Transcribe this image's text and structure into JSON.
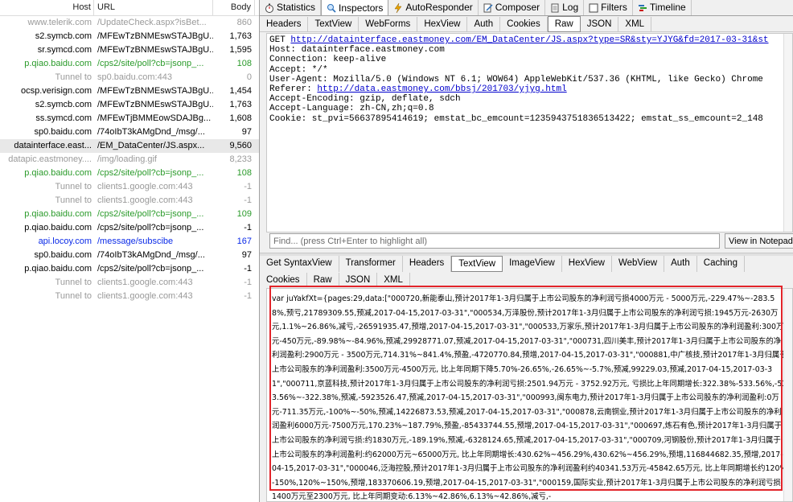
{
  "sessions": {
    "headers": {
      "host": "Host",
      "url": "URL",
      "body": "Body"
    },
    "rows": [
      {
        "host": "www.telerik.com",
        "url": "/UpdateCheck.aspx?isBet...",
        "body": "860",
        "style": "gray"
      },
      {
        "host": "s2.symcb.com",
        "url": "/MFEwTzBNMEswSTAJBgU...",
        "body": "1,763",
        "style": ""
      },
      {
        "host": "sr.symcd.com",
        "url": "/MFEwTzBNMEswSTAJBgU...",
        "body": "1,595",
        "style": ""
      },
      {
        "host": "p.qiao.baidu.com",
        "url": "/cps2/site/poll?cb=jsonp_...",
        "body": "108",
        "style": "green"
      },
      {
        "host": "Tunnel to",
        "url": "sp0.baidu.com:443",
        "body": "0",
        "style": "gray"
      },
      {
        "host": "ocsp.verisign.com",
        "url": "/MFEwTzBNMEswSTAJBgU...",
        "body": "1,454",
        "style": ""
      },
      {
        "host": "s2.symcb.com",
        "url": "/MFEwTzBNMEswSTAJBgU...",
        "body": "1,763",
        "style": ""
      },
      {
        "host": "ss.symcd.com",
        "url": "/MFEwTjBMMEowSDAJBg...",
        "body": "1,608",
        "style": ""
      },
      {
        "host": "sp0.baidu.com",
        "url": "/74oIbT3kAMgDnd_/msg/...",
        "body": "97",
        "style": ""
      },
      {
        "host": "datainterface.east...",
        "url": "/EM_DataCenter/JS.aspx...",
        "body": "9,560",
        "style": "sel"
      },
      {
        "host": "datapic.eastmoney....",
        "url": "/img/loading.gif",
        "body": "8,233",
        "style": "gray"
      },
      {
        "host": "p.qiao.baidu.com",
        "url": "/cps2/site/poll?cb=jsonp_...",
        "body": "108",
        "style": "green"
      },
      {
        "host": "Tunnel to",
        "url": "clients1.google.com:443",
        "body": "-1",
        "style": "gray"
      },
      {
        "host": "Tunnel to",
        "url": "clients1.google.com:443",
        "body": "-1",
        "style": "gray"
      },
      {
        "host": "p.qiao.baidu.com",
        "url": "/cps2/site/poll?cb=jsonp_...",
        "body": "109",
        "style": "green"
      },
      {
        "host": "p.qiao.baidu.com",
        "url": "/cps2/site/poll?cb=jsonp_...",
        "body": "-1",
        "style": ""
      },
      {
        "host": "api.locoy.com",
        "url": "/message/subscibe",
        "body": "167",
        "style": "blue"
      },
      {
        "host": "sp0.baidu.com",
        "url": "/74oIbT3kAMgDnd_/msg/...",
        "body": "97",
        "style": ""
      },
      {
        "host": "p.qiao.baidu.com",
        "url": "/cps2/site/poll?cb=jsonp_...",
        "body": "-1",
        "style": ""
      },
      {
        "host": "Tunnel to",
        "url": "clients1.google.com:443",
        "body": "-1",
        "style": "gray"
      },
      {
        "host": "Tunnel to",
        "url": "clients1.google.com:443",
        "body": "-1",
        "style": "gray"
      }
    ]
  },
  "top_tabs": [
    {
      "label": "Statistics",
      "icon": "stopwatch-icon"
    },
    {
      "label": "Inspectors",
      "icon": "inspect-icon",
      "active": true
    },
    {
      "label": "AutoResponder",
      "icon": "lightning-icon"
    },
    {
      "label": "Composer",
      "icon": "compose-icon"
    },
    {
      "label": "Log",
      "icon": "log-icon"
    },
    {
      "label": "Filters",
      "icon": "checkbox-icon"
    },
    {
      "label": "Timeline",
      "icon": "timeline-icon"
    }
  ],
  "request_tabs": [
    "Headers",
    "TextView",
    "WebForms",
    "HexView",
    "Auth",
    "Cookies",
    "Raw",
    "JSON",
    "XML"
  ],
  "request_active": "Raw",
  "request": {
    "method": "GET",
    "url": "http://datainterface.eastmoney.com/EM_DataCenter/JS.aspx?type=SR&sty=YJYG&fd=2017-03-31&st",
    "host": "Host: datainterface.eastmoney.com",
    "connection": "Connection: keep-alive",
    "accept": "Accept: */*",
    "user_agent": "User-Agent: Mozilla/5.0 (Windows NT 6.1; WOW64) AppleWebKit/537.36 (KHTML, like Gecko) Chrome",
    "referer_label": "Referer: ",
    "referer_url": "http://data.eastmoney.com/bbsj/201703/yjyg.html",
    "encoding": "Accept-Encoding: gzip, deflate, sdch",
    "language": "Accept-Language: zh-CN,zh;q=0.8",
    "cookie": "Cookie: st_pvi=56637895414619; emstat_bc_emcount=1235943751836513422; emstat_ss_emcount=2_148"
  },
  "find": {
    "placeholder": "Find... (press Ctrl+Enter to highlight all)",
    "button": "View in Notepad"
  },
  "response_tabs_row1": [
    "Get SyntaxView",
    "Transformer",
    "Headers",
    "TextView",
    "ImageView",
    "HexView",
    "WebView",
    "Auth",
    "Caching"
  ],
  "response_tabs_row2": [
    "Cookies",
    "Raw",
    "JSON",
    "XML"
  ],
  "response_active": "TextView",
  "response_text": "var juYakfXt={pages:29,data:[\"000720,新能泰山,预计2017年1-3月归属于上市公司股东的净利润亏损4000万元 - 5000万元,-229.47%~-283.58%,预亏,21789309.55,预减,2017-04-15,2017-03-31\",\"000534,万泽股份,预计2017年1-3月归属于上市公司股东的净利润亏损:1945万元-2630万元,1.1%~26.86%,减亏,-26591935.47,预增,2017-04-15,2017-03-31\",\"000533,万家乐,预计2017年1-3月归属于上市公司股东的净利润盈利:300万元-450万元,-89.98%~-84.96%,预减,29928771.07,预减,2017-04-15,2017-03-31\",\"000731,四川美丰,预计2017年1-3月归属于上市公司股东的净利润盈利:2900万元 - 3500万元,714.31%~841.4%,预盈,-4720770.84,预增,2017-04-15,2017-03-31\",\"000881,中广核技,预计2017年1-3月归属于上市公司股东的净利润盈利:3500万元-4500万元, 比上年同期下降5.70%-26.65%,-26.65%~-5.7%,预减,99229.03,预减,2017-04-15,2017-03-31\",\"000711,京蓝科技,预计2017年1-3月归属于上市公司股东的净利润亏损:2501.94万元 - 3752.92万元, 亏损比上年同期增长:322.38%-533.56%,-533.56%~-322.38%,预减,-5923526.47,预减,2017-04-15,2017-03-31\",\"000993,闽东电力,预计2017年1-3月归属于上市公司股东的净利润盈利:0万元-711.35万元,-100%~-50%,预减,14226873.53,预减,2017-04-15,2017-03-31\",\"000878,云南铜业,预计2017年1-3月归属于上市公司股东的净利润盈利6000万元-7500万元,170.23%~187.79%,预盈,-85433744.55,预增,2017-04-15,2017-03-31\",\"000697,炼石有色,预计2017年1-3月归属于上市公司股东的净利润亏损:约1830万元,-189.19%,预减,-6328124.65,预减,2017-04-15,2017-03-31\",\"000709,河钢股份,预计2017年1-3月归属于上市公司股东的净利润盈利:约62000万元~65000万元, 比上年同期增长:430.62%~456.29%,430.62%~456.29%,预增,116844682.35,预增,2017-04-15,2017-03-31\",\"000046,泛海控股,预计2017年1-3月归属于上市公司股东的净利润盈利约40341.53万元-45842.65万元, 比上年同期增长约120%-150%,120%~150%,预增,183370606.19,预增,2017-04-15,2017-03-31\",\"000159,国际实业,预计2017年1-3月归属于上市公司股东的净利润亏损:1400万元至2300万元, 比上年同期变动:6.13%~42.86%,6.13%~42.86%,减亏,-"
}
